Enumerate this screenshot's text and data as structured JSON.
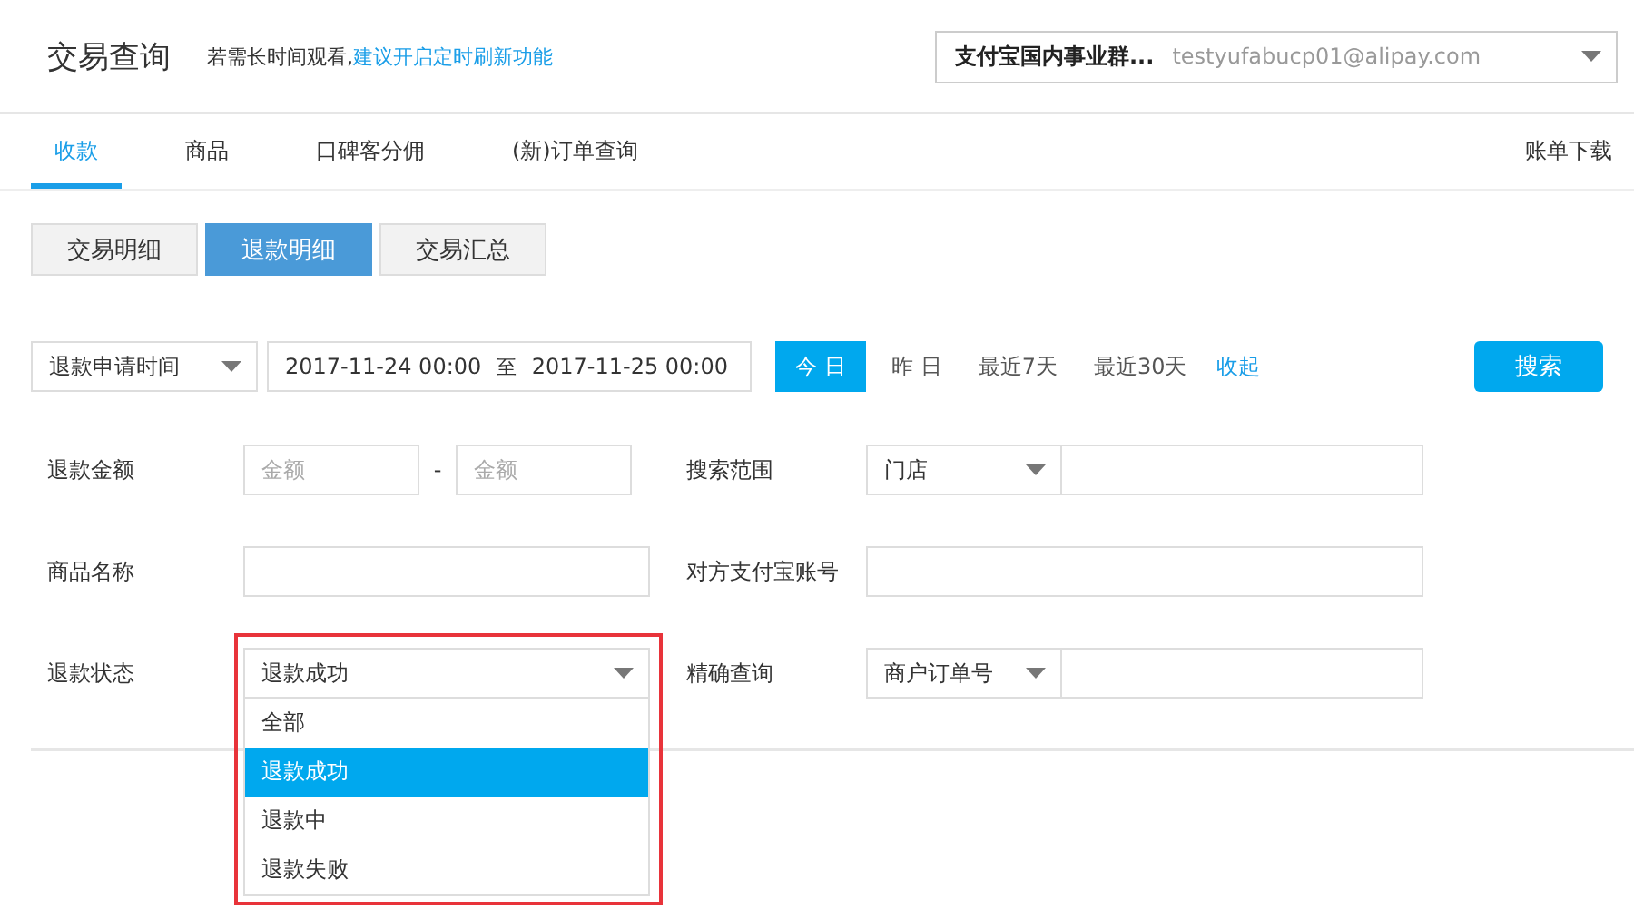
{
  "header": {
    "title": "交易查询",
    "hint": "若需长时间观看,",
    "hint_link": "建议开启定时刷新功能",
    "account": {
      "name": "支付宝国内事业群...",
      "email": "testyufabucp01@alipay.com"
    }
  },
  "tabs": [
    {
      "label": "收款",
      "selected": true
    },
    {
      "label": "商品",
      "selected": false
    },
    {
      "label": "口碑客分佣",
      "selected": false
    },
    {
      "label": "(新)订单查询",
      "selected": false
    }
  ],
  "download_link": "账单下载",
  "subtabs": [
    {
      "label": "交易明细",
      "selected": false
    },
    {
      "label": "退款明细",
      "selected": true
    },
    {
      "label": "交易汇总",
      "selected": false
    }
  ],
  "time_filter": {
    "type": "退款申请时间",
    "start": "2017-11-24 00:00",
    "separator": "至",
    "end": "2017-11-25 00:00"
  },
  "quick_ranges": [
    {
      "label": "今 日",
      "selected": true
    },
    {
      "label": "昨 日",
      "selected": false
    },
    {
      "label": "最近7天",
      "selected": false
    },
    {
      "label": "最近30天",
      "selected": false
    }
  ],
  "collapse_link": "收起",
  "search_button": "搜索",
  "rows": [
    {
      "left": {
        "label": "退款金额",
        "kind": "range",
        "min_placeholder": "金额",
        "separator": "-",
        "max_placeholder": "金额"
      },
      "right": {
        "label": "搜索范围",
        "kind": "select_input",
        "select": "门店"
      }
    },
    {
      "left": {
        "label": "商品名称",
        "kind": "text"
      },
      "right": {
        "label": "对方支付宝账号",
        "kind": "text"
      }
    },
    {
      "left": {
        "label": "退款状态",
        "kind": "dropdown",
        "value": "退款成功",
        "expanded": true,
        "highlighted": true,
        "options": [
          {
            "label": "全部",
            "selected": false
          },
          {
            "label": "退款成功",
            "selected": true
          },
          {
            "label": "退款中",
            "selected": false
          },
          {
            "label": "退款失败",
            "selected": false
          }
        ]
      },
      "right": {
        "label": "精确查询",
        "kind": "select_input",
        "select": "商户订单号"
      }
    }
  ]
}
